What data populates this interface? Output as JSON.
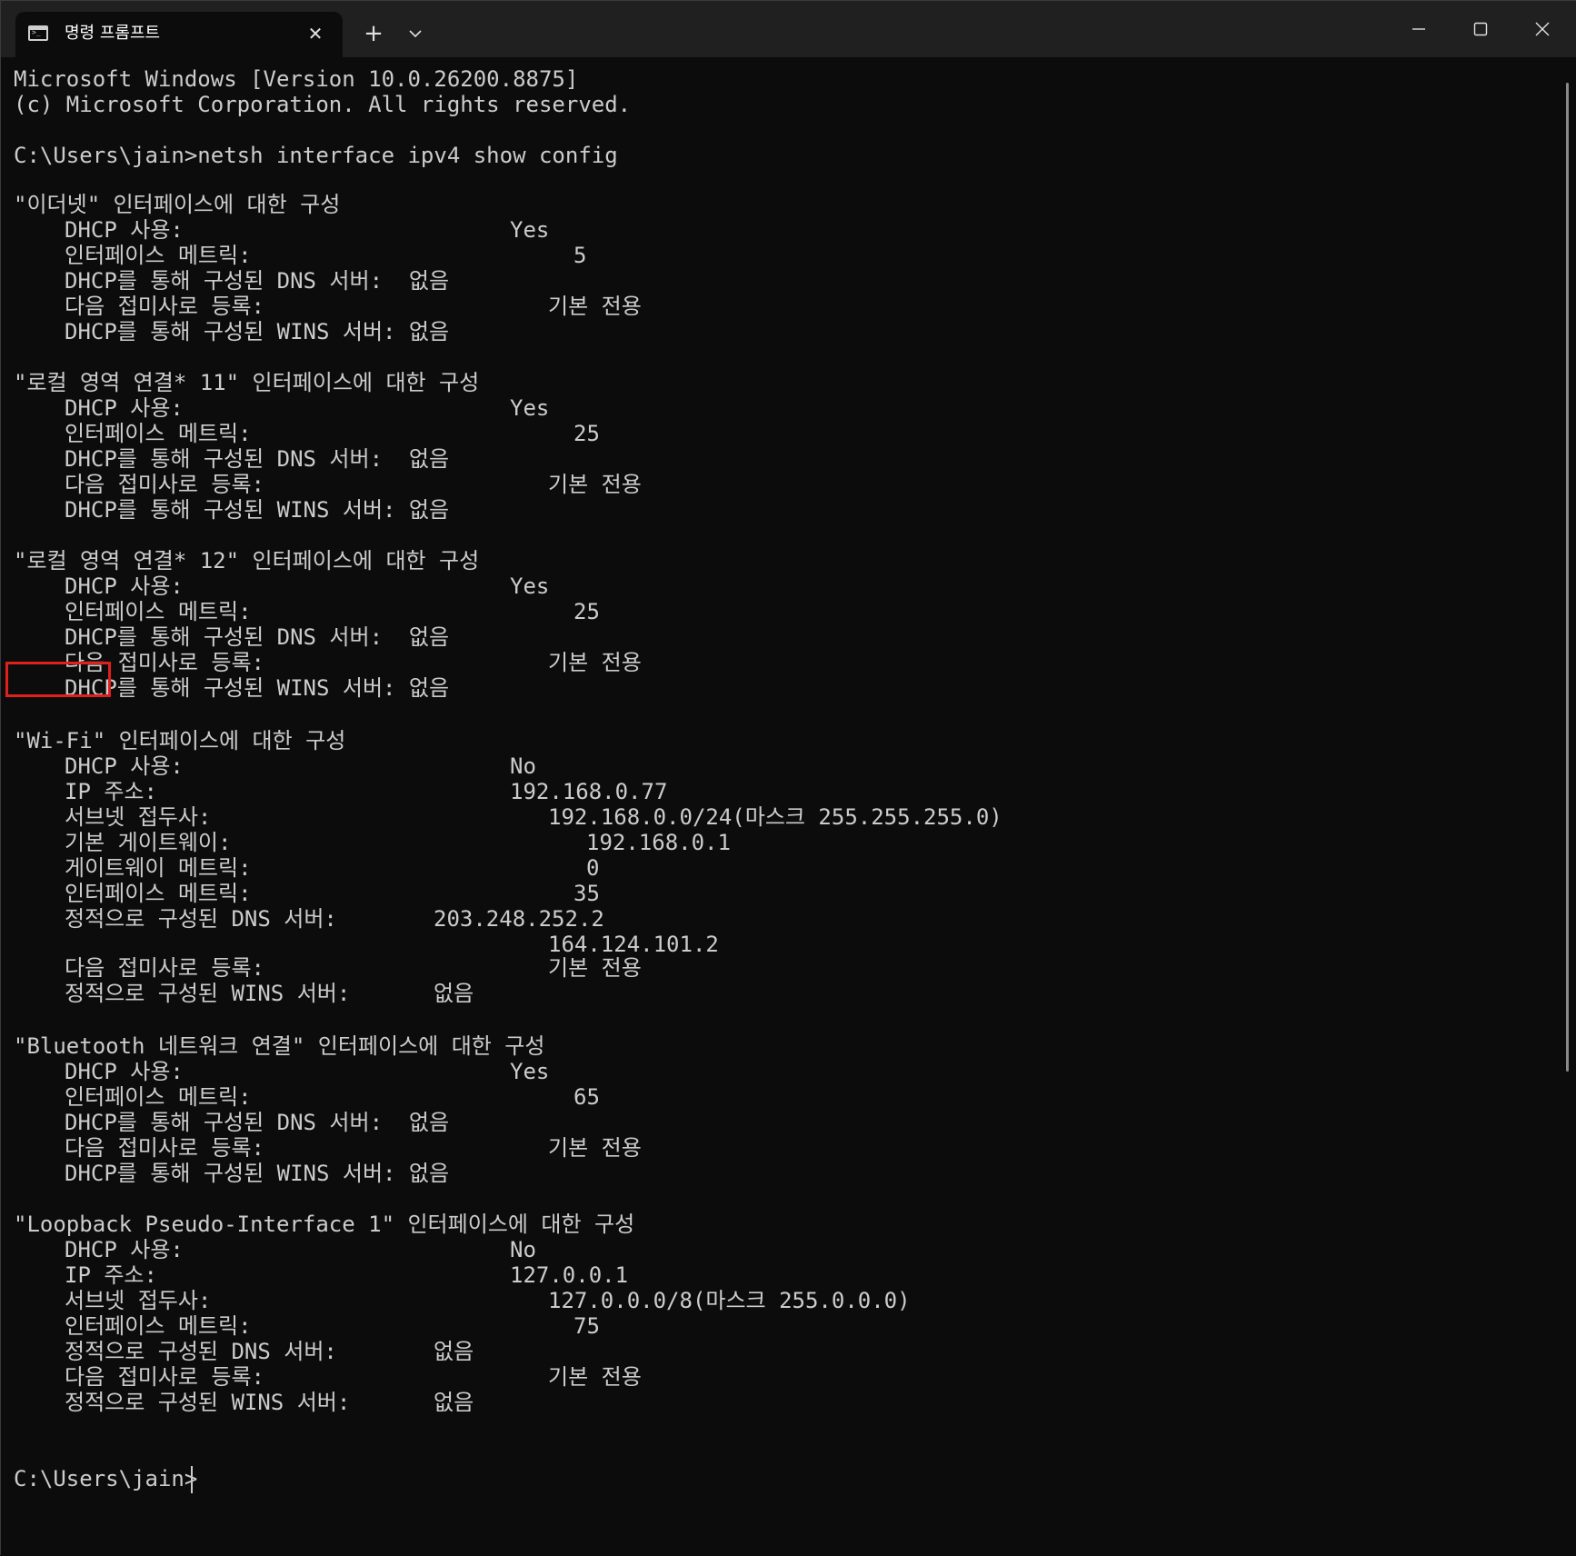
{
  "window": {
    "tab_title": "명령 프롬프트",
    "tab_close": "✕",
    "new_tab": "+"
  },
  "terminal": {
    "lines": [
      {
        "text": "Microsoft Windows [Version 10.0.26200.8875]"
      },
      {
        "text": "(c) Microsoft Corporation. All rights reserved."
      },
      {
        "text": "C:\\Users\\jain>netsh interface ipv4 show config"
      },
      {
        "text": "\"이더넷\" 인터페이스에 대한 구성"
      },
      {
        "text": "DHCP 사용:"
      },
      {
        "text": "Yes"
      },
      {
        "text": "인터페이스 메트릭:"
      },
      {
        "text": "5"
      },
      {
        "text": "DHCP를 통해 구성된 DNS 서버:  없음"
      },
      {
        "text": "다음 접미사로 등록:"
      },
      {
        "text": "기본 전용"
      },
      {
        "text": "DHCP를 통해 구성된 WINS 서버: 없음"
      },
      {
        "text": "\"로컬 영역 연결* 11\" 인터페이스에 대한 구성"
      },
      {
        "text": "DHCP 사용:"
      },
      {
        "text": "Yes"
      },
      {
        "text": "인터페이스 메트릭:"
      },
      {
        "text": "25"
      },
      {
        "text": "DHCP를 통해 구성된 DNS 서버:  없음"
      },
      {
        "text": "다음 접미사로 등록:"
      },
      {
        "text": "기본 전용"
      },
      {
        "text": "DHCP를 통해 구성된 WINS 서버: 없음"
      },
      {
        "text": "\"로컬 영역 연결* 12\" 인터페이스에 대한 구성"
      },
      {
        "text": "DHCP 사용:"
      },
      {
        "text": "Yes"
      },
      {
        "text": "인터페이스 메트릭:"
      },
      {
        "text": "25"
      },
      {
        "text": "DHCP를 통해 구성된 DNS 서버:  없음"
      },
      {
        "text": "다음 접미사로 등록:"
      },
      {
        "text": "기본 전용"
      },
      {
        "text": "DHCP를 통해 구성된 WINS 서버: 없음"
      },
      {
        "text": "\"Wi-Fi\" 인터페이스에 대한 구성"
      },
      {
        "text": "DHCP 사용:"
      },
      {
        "text": "No"
      },
      {
        "text": "IP 주소:"
      },
      {
        "text": "192.168.0.77"
      },
      {
        "text": "서브넷 접두사:"
      },
      {
        "text": "192.168.0.0/24(마스크 255.255.255.0)"
      },
      {
        "text": "기본 게이트웨이:"
      },
      {
        "text": "192.168.0.1"
      },
      {
        "text": "게이트웨이 메트릭:"
      },
      {
        "text": "0"
      },
      {
        "text": "인터페이스 메트릭:"
      },
      {
        "text": "35"
      },
      {
        "text": "정적으로 구성된 DNS 서버:"
      },
      {
        "text": "203.248.252.2"
      },
      {
        "text": "164.124.101.2"
      },
      {
        "text": "다음 접미사로 등록:"
      },
      {
        "text": "기본 전용"
      },
      {
        "text": "정적으로 구성된 WINS 서버:"
      },
      {
        "text": "없음"
      },
      {
        "text": "\"Bluetooth 네트워크 연결\" 인터페이스에 대한 구성"
      },
      {
        "text": "DHCP 사용:"
      },
      {
        "text": "Yes"
      },
      {
        "text": "인터페이스 메트릭:"
      },
      {
        "text": "65"
      },
      {
        "text": "DHCP를 통해 구성된 DNS 서버:  없음"
      },
      {
        "text": "다음 접미사로 등록:"
      },
      {
        "text": "기본 전용"
      },
      {
        "text": "DHCP를 통해 구성된 WINS 서버: 없음"
      },
      {
        "text": "\"Loopback Pseudo-Interface 1\" 인터페이스에 대한 구성"
      },
      {
        "text": "DHCP 사용:"
      },
      {
        "text": "No"
      },
      {
        "text": "IP 주소:"
      },
      {
        "text": "127.0.0.1"
      },
      {
        "text": "서브넷 접두사:"
      },
      {
        "text": "127.0.0.0/8(마스크 255.0.0.0)"
      },
      {
        "text": "인터페이스 메트릭:"
      },
      {
        "text": "75"
      },
      {
        "text": "정적으로 구성된 DNS 서버:"
      },
      {
        "text": "없음"
      },
      {
        "text": "다음 접미사로 등록:"
      },
      {
        "text": "기본 전용"
      },
      {
        "text": "정적으로 구성된 WINS 서버:"
      },
      {
        "text": "없음"
      },
      {
        "text": "C:\\Users\\jain>"
      }
    ]
  }
}
